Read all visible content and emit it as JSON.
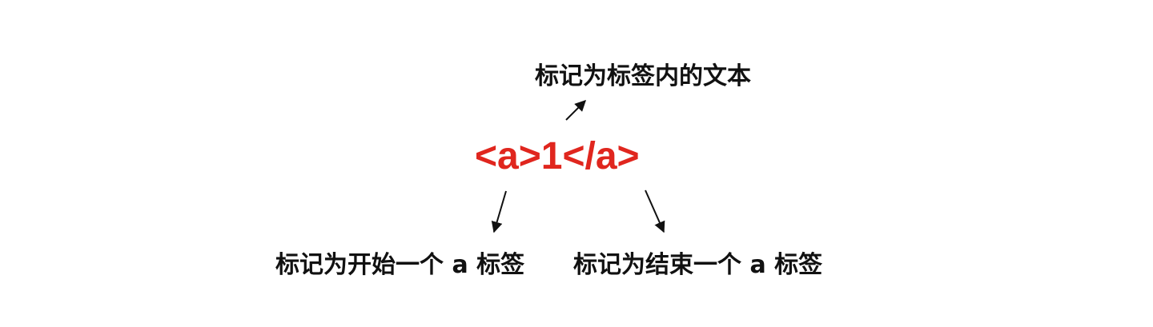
{
  "diagram": {
    "code_text": "<a>1</a>",
    "labels": {
      "inner_text": "标记为标签内的文本",
      "start_tag": "标记为开始一个 a 标签",
      "end_tag": "标记为结束一个 a 标签"
    },
    "colors": {
      "code": "#e0261e",
      "label": "#111111",
      "arrow": "#111111",
      "background": "#ffffff"
    }
  }
}
